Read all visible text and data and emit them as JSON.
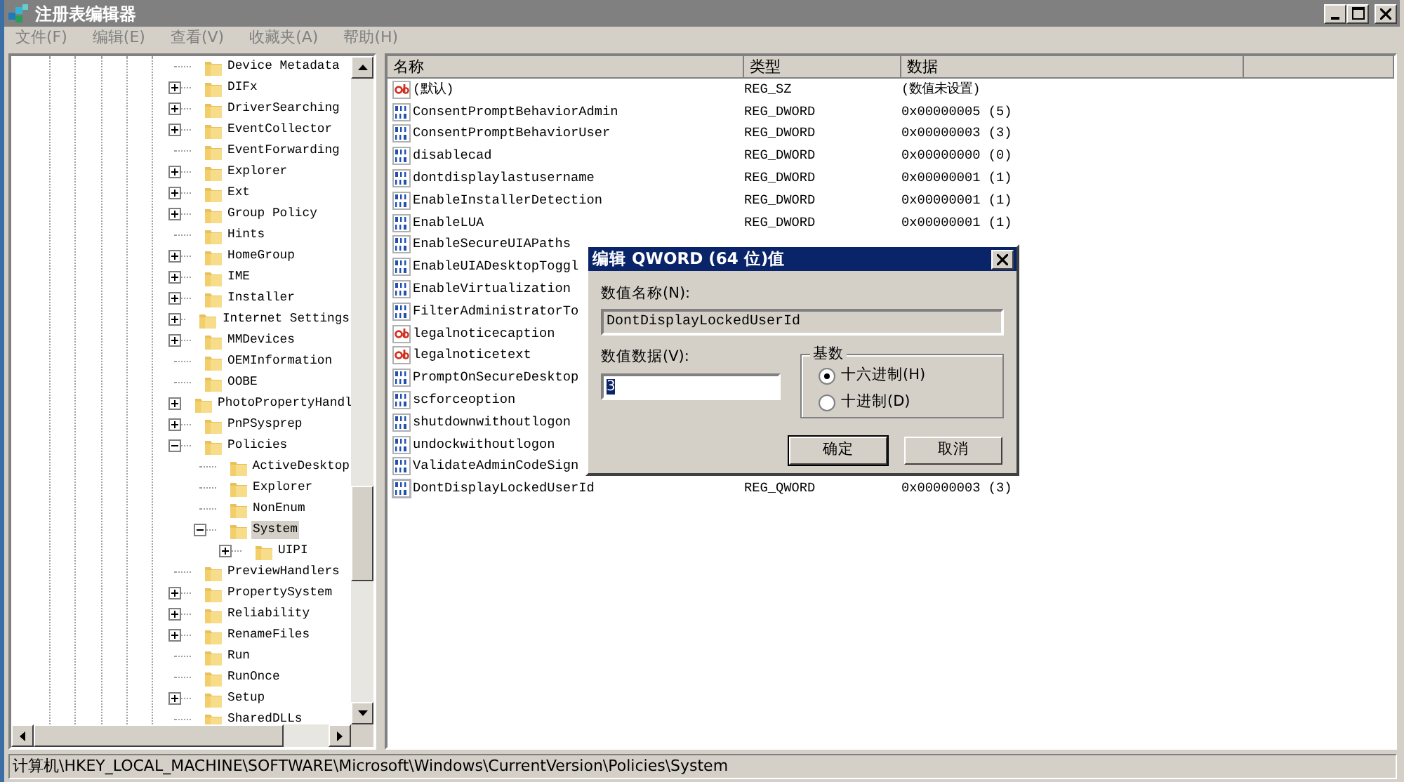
{
  "window": {
    "title": "注册表编辑器"
  },
  "menu": [
    "文件(F)",
    "编辑(E)",
    "查看(V)",
    "收藏夹(A)",
    "帮助(H)"
  ],
  "tree": [
    {
      "label": "Device Metadata",
      "expandable": false,
      "selected": false
    },
    {
      "label": "DIFx",
      "expandable": true,
      "expanded": false,
      "selected": false
    },
    {
      "label": "DriverSearching",
      "expandable": true,
      "expanded": false,
      "selected": false
    },
    {
      "label": "EventCollector",
      "expandable": true,
      "expanded": false,
      "selected": false
    },
    {
      "label": "EventForwarding",
      "expandable": false,
      "selected": false
    },
    {
      "label": "Explorer",
      "expandable": true,
      "expanded": false,
      "selected": false
    },
    {
      "label": "Ext",
      "expandable": true,
      "expanded": false,
      "selected": false
    },
    {
      "label": "Group Policy",
      "expandable": true,
      "expanded": false,
      "selected": false
    },
    {
      "label": "Hints",
      "expandable": false,
      "selected": false
    },
    {
      "label": "HomeGroup",
      "expandable": true,
      "expanded": false,
      "selected": false
    },
    {
      "label": "IME",
      "expandable": true,
      "expanded": false,
      "selected": false
    },
    {
      "label": "Installer",
      "expandable": true,
      "expanded": false,
      "selected": false
    },
    {
      "label": "Internet Settings",
      "expandable": true,
      "expanded": false,
      "selected": false
    },
    {
      "label": "MMDevices",
      "expandable": true,
      "expanded": false,
      "selected": false
    },
    {
      "label": "OEMInformation",
      "expandable": false,
      "selected": false
    },
    {
      "label": "OOBE",
      "expandable": false,
      "selected": false
    },
    {
      "label": "PhotoPropertyHandl",
      "expandable": true,
      "expanded": false,
      "selected": false
    },
    {
      "label": "PnPSysprep",
      "expandable": true,
      "expanded": false,
      "selected": false
    },
    {
      "label": "Policies",
      "expandable": true,
      "expanded": true,
      "selected": false,
      "children": [
        {
          "label": "ActiveDesktop",
          "expandable": false,
          "selected": false
        },
        {
          "label": "Explorer",
          "expandable": false,
          "selected": false
        },
        {
          "label": "NonEnum",
          "expandable": false,
          "selected": false
        },
        {
          "label": "System",
          "expandable": true,
          "expanded": true,
          "selected": true,
          "children": [
            {
              "label": "UIPI",
              "expandable": true,
              "expanded": false,
              "selected": false
            }
          ]
        }
      ]
    },
    {
      "label": "PreviewHandlers",
      "expandable": false,
      "selected": false
    },
    {
      "label": "PropertySystem",
      "expandable": true,
      "expanded": false,
      "selected": false
    },
    {
      "label": "Reliability",
      "expandable": true,
      "expanded": false,
      "selected": false
    },
    {
      "label": "RenameFiles",
      "expandable": true,
      "expanded": false,
      "selected": false
    },
    {
      "label": "Run",
      "expandable": false,
      "selected": false
    },
    {
      "label": "RunOnce",
      "expandable": false,
      "selected": false
    },
    {
      "label": "Setup",
      "expandable": true,
      "expanded": false,
      "selected": false
    },
    {
      "label": "SharedDLLs",
      "expandable": false,
      "selected": false
    }
  ],
  "values": {
    "columns": [
      "名称",
      "类型",
      "数据"
    ],
    "rows": [
      {
        "kind": "string",
        "name": "(默认)",
        "type": "REG_SZ",
        "data": "(数值未设置)",
        "selected": false
      },
      {
        "kind": "binary",
        "name": "ConsentPromptBehaviorAdmin",
        "type": "REG_DWORD",
        "data": "0x00000005 (5)",
        "selected": false
      },
      {
        "kind": "binary",
        "name": "ConsentPromptBehaviorUser",
        "type": "REG_DWORD",
        "data": "0x00000003 (3)",
        "selected": false
      },
      {
        "kind": "binary",
        "name": "disablecad",
        "type": "REG_DWORD",
        "data": "0x00000000 (0)",
        "selected": false
      },
      {
        "kind": "binary",
        "name": "dontdisplaylastusername",
        "type": "REG_DWORD",
        "data": "0x00000001 (1)",
        "selected": false
      },
      {
        "kind": "binary",
        "name": "EnableInstallerDetection",
        "type": "REG_DWORD",
        "data": "0x00000001 (1)",
        "selected": false
      },
      {
        "kind": "binary",
        "name": "EnableLUA",
        "type": "REG_DWORD",
        "data": "0x00000001 (1)",
        "selected": false
      },
      {
        "kind": "binary",
        "name": "EnableSecureUIAPaths",
        "selected": false
      },
      {
        "kind": "binary",
        "name": "EnableUIADesktopToggl",
        "selected": false
      },
      {
        "kind": "binary",
        "name": "EnableVirtualization",
        "selected": false
      },
      {
        "kind": "binary",
        "name": "FilterAdministratorTo",
        "selected": false
      },
      {
        "kind": "string",
        "name": "legalnoticecaption",
        "selected": false
      },
      {
        "kind": "string",
        "name": "legalnoticetext",
        "selected": false
      },
      {
        "kind": "binary",
        "name": "PromptOnSecureDesktop",
        "selected": false
      },
      {
        "kind": "binary",
        "name": "scforceoption",
        "selected": false
      },
      {
        "kind": "binary",
        "name": "shutdownwithoutlogon",
        "selected": false
      },
      {
        "kind": "binary",
        "name": "undockwithoutlogon",
        "selected": false
      },
      {
        "kind": "binary",
        "name": "ValidateAdminCodeSign",
        "selected": false
      },
      {
        "kind": "binary",
        "name": "DontDisplayLockedUserId",
        "type": "REG_QWORD",
        "data": "0x00000003 (3)",
        "selected": true
      }
    ]
  },
  "status_bar": "计算机\\HKEY_LOCAL_MACHINE\\SOFTWARE\\Microsoft\\Windows\\CurrentVersion\\Policies\\System",
  "dialog": {
    "title": "编辑 QWORD (64 位)值",
    "name_label": "数值名称(N):",
    "name_value": "DontDisplayLockedUserId",
    "data_label": "数值数据(V):",
    "data_value": "3",
    "base_label": "基数",
    "radios": [
      {
        "label": "十六进制(H)",
        "selected": true
      },
      {
        "label": "十进制(D)",
        "selected": false
      }
    ],
    "buttons": [
      {
        "label": "确定",
        "default": true
      },
      {
        "label": "取消",
        "default": false
      }
    ]
  }
}
